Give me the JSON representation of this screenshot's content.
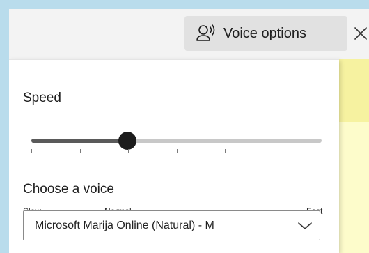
{
  "toolbar": {
    "voice_options_label": "Voice options",
    "voice_icon": "voice-person-icon",
    "close_icon": "close-icon"
  },
  "panel": {
    "speed": {
      "title": "Speed",
      "labels": {
        "slow": "Slow",
        "normal": "Normal",
        "fast": "Fast"
      },
      "value_fraction": 0.33,
      "tick_count": 7
    },
    "voice": {
      "title": "Choose a voice",
      "selected": "Microsoft Marija Online (Natural) - M"
    }
  },
  "colors": {
    "page_background": "#b9dcec",
    "window_background": "#f3f3f3",
    "button_background": "#e1e1e1",
    "panel_background": "#ffffff",
    "slider_thumb": "#1c1c1c",
    "reading_highlight": "#f6f2a0",
    "reading_background": "#fdfccb"
  }
}
